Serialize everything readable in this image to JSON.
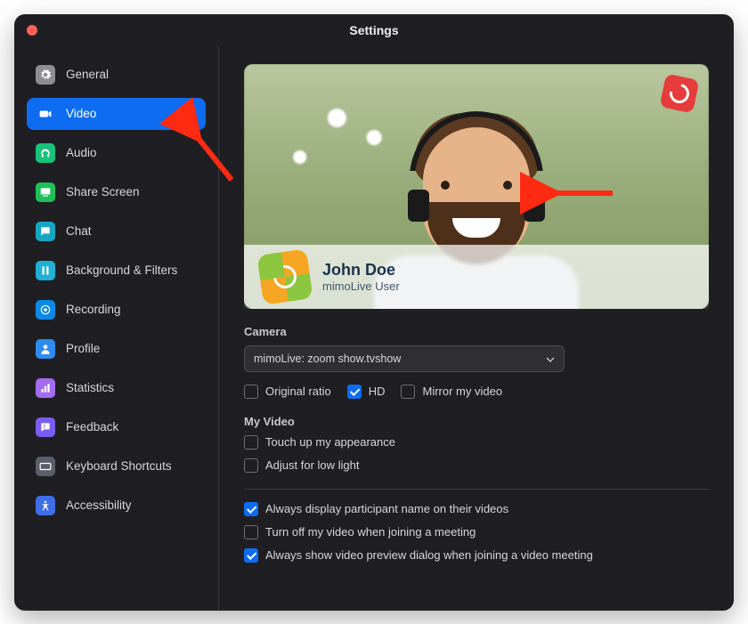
{
  "window": {
    "title": "Settings"
  },
  "sidebar": {
    "items": [
      {
        "id": "general",
        "label": "General",
        "icon": "gear-icon",
        "color": "#8d8d92"
      },
      {
        "id": "video",
        "label": "Video",
        "icon": "video-icon",
        "color": "#0e6cf1",
        "active": true
      },
      {
        "id": "audio",
        "label": "Audio",
        "icon": "headphones-icon",
        "color": "#17c27a"
      },
      {
        "id": "share",
        "label": "Share Screen",
        "icon": "share-screen-icon",
        "color": "#1fbf5a"
      },
      {
        "id": "chat",
        "label": "Chat",
        "icon": "chat-icon",
        "color": "#17a6c2"
      },
      {
        "id": "bgfilters",
        "label": "Background & Filters",
        "icon": "filters-icon",
        "color": "#1fb0d6"
      },
      {
        "id": "recording",
        "label": "Recording",
        "icon": "record-icon",
        "color": "#0c88e6"
      },
      {
        "id": "profile",
        "label": "Profile",
        "icon": "profile-icon",
        "color": "#2e8bf0"
      },
      {
        "id": "stats",
        "label": "Statistics",
        "icon": "stats-icon",
        "color": "#a46cf0"
      },
      {
        "id": "feedback",
        "label": "Feedback",
        "icon": "feedback-icon",
        "color": "#7a5cf0"
      },
      {
        "id": "shortcuts",
        "label": "Keyboard Shortcuts",
        "icon": "keyboard-icon",
        "color": "#5b5f6b"
      },
      {
        "id": "a11y",
        "label": "Accessibility",
        "icon": "accessibility-icon",
        "color": "#3f6fe6"
      }
    ]
  },
  "preview": {
    "user_name": "John Doe",
    "user_subtitle": "mimoLive User"
  },
  "camera": {
    "label": "Camera",
    "selected": "mimoLive: zoom show.tvshow",
    "options_row": [
      {
        "id": "original_ratio",
        "label": "Original ratio",
        "checked": false
      },
      {
        "id": "hd",
        "label": "HD",
        "checked": true
      },
      {
        "id": "mirror",
        "label": "Mirror my video",
        "checked": false
      }
    ]
  },
  "my_video": {
    "label": "My Video",
    "options": [
      {
        "id": "touchup",
        "label": "Touch up my appearance",
        "checked": false
      },
      {
        "id": "lowlight",
        "label": "Adjust for low light",
        "checked": false
      }
    ]
  },
  "meeting_options": [
    {
      "id": "display_name",
      "label": "Always display participant name on their videos",
      "checked": true
    },
    {
      "id": "turn_off_join",
      "label": "Turn off my video when joining a meeting",
      "checked": false
    },
    {
      "id": "preview_join",
      "label": "Always show video preview dialog when joining a video meeting",
      "checked": true
    }
  ],
  "annotations": {
    "arrow_sidebar": true,
    "arrow_dropdown": true
  }
}
